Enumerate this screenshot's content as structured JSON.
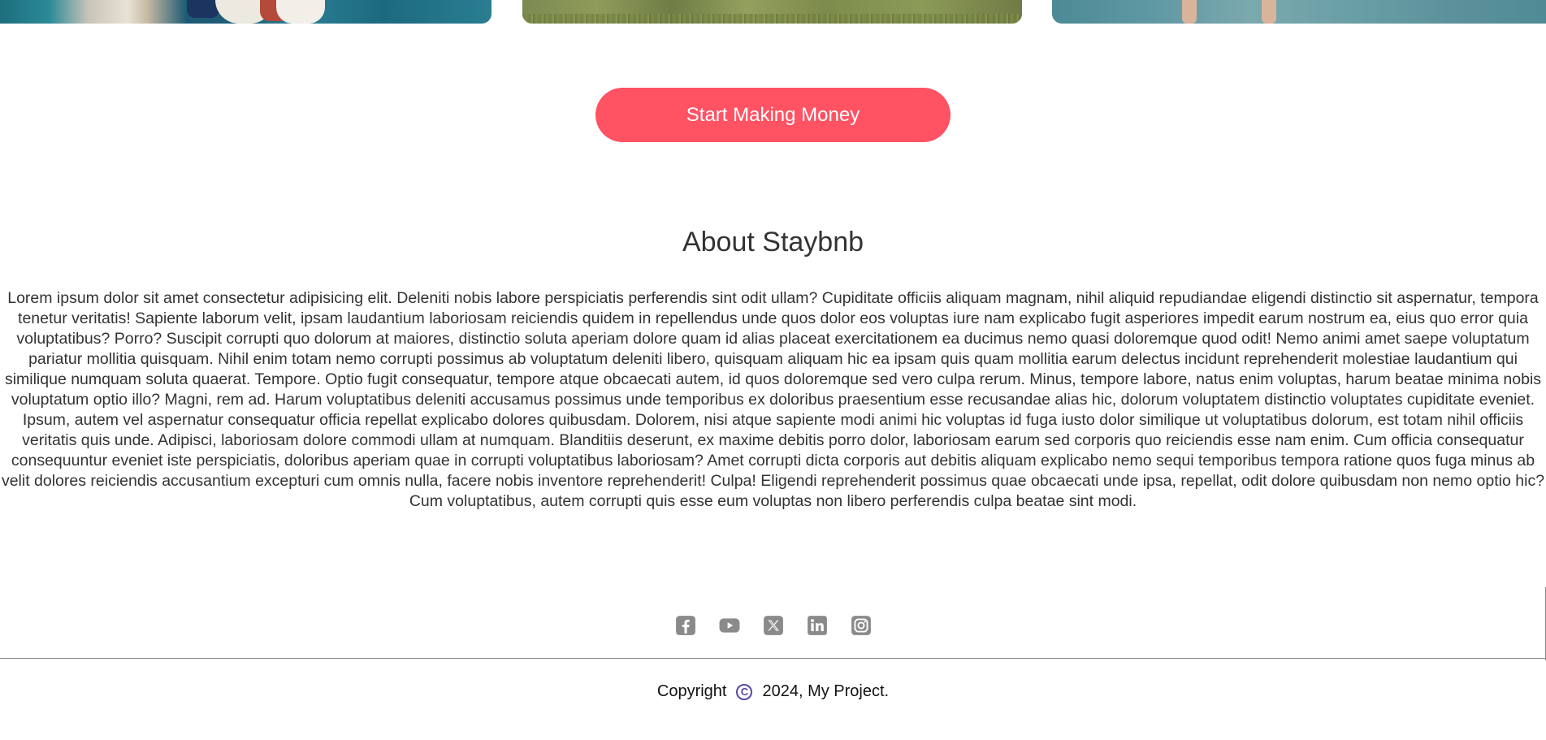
{
  "cta": {
    "label": "Start Making Money",
    "color": "#ff5263"
  },
  "about": {
    "title": "About Staybnb",
    "body": "Lorem ipsum dolor sit amet consectetur adipisicing elit. Deleniti nobis labore perspiciatis perferendis sint odit ullam? Cupiditate officiis aliquam magnam, nihil aliquid repudiandae eligendi distinctio sit aspernatur, tempora tenetur veritatis! Sapiente laborum velit, ipsam laudantium laboriosam reiciendis quidem in repellendus unde quos dolor eos voluptas iure nam explicabo fugit asperiores impedit earum nostrum ea, eius quo error quia voluptatibus? Porro? Suscipit corrupti quo dolorum at maiores, distinctio soluta aperiam dolore quam id alias placeat exercitationem ea ducimus nemo quasi doloremque quod odit! Nemo animi amet saepe voluptatum pariatur mollitia quisquam. Nihil enim totam nemo corrupti possimus ab voluptatum deleniti libero, quisquam aliquam hic ea ipsam quis quam mollitia earum delectus incidunt reprehenderit molestiae laudantium qui similique numquam soluta quaerat. Tempore. Optio fugit consequatur, tempore atque obcaecati autem, id quos doloremque sed vero culpa rerum. Minus, tempore labore, natus enim voluptas, harum beatae minima nobis voluptatum optio illo? Magni, rem ad. Harum voluptatibus deleniti accusamus possimus unde temporibus ex doloribus praesentium esse recusandae alias hic, dolorum voluptatem distinctio voluptates cupiditate eveniet. Ipsum, autem vel aspernatur consequatur officia repellat explicabo dolores quibusdam. Dolorem, nisi atque sapiente modi animi hic voluptas id fuga iusto dolor similique ut voluptatibus dolorum, est totam nihil officiis veritatis quis unde. Adipisci, laboriosam dolore commodi ullam at numquam. Blanditiis deserunt, ex maxime debitis porro dolor, laboriosam earum sed corporis quo reiciendis esse nam enim. Cum officia consequatur consequuntur eveniet iste perspiciatis, doloribus aperiam quae in corrupti voluptatibus laboriosam? Amet corrupti dicta corporis aut debitis aliquam explicabo nemo sequi temporibus tempora ratione quos fuga minus ab velit dolores reiciendis accusantium excepturi cum omnis nulla, facere nobis inventore reprehenderit! Culpa! Eligendi reprehenderit possimus quae obcaecati unde ipsa, repellat, odit dolore quibusdam non nemo optio hic? Cum voluptatibus, autem corrupti quis esse eum voluptas non libero perferendis culpa beatae sint modi."
  },
  "social": {
    "icon_color": "#8a8a8a",
    "icons": [
      "facebook-icon",
      "youtube-icon",
      "x-twitter-icon",
      "linkedin-icon",
      "instagram-icon"
    ]
  },
  "footer": {
    "copyright_prefix": "Copyright",
    "copyright_symbol": "C",
    "copyright_suffix": "2024, My Project.",
    "symbol_color": "#5a48a8"
  }
}
